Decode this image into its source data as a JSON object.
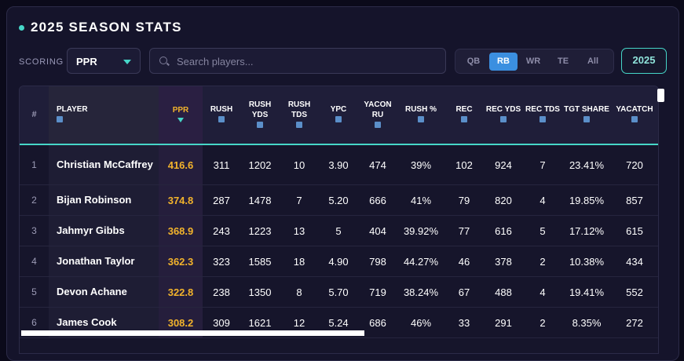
{
  "header": {
    "title": "2025 SEASON STATS"
  },
  "controls": {
    "scoring_label": "SCORING",
    "scoring_value": "PPR",
    "search_placeholder": "Search players...",
    "positions": [
      "QB",
      "RB",
      "WR",
      "TE",
      "All"
    ],
    "active_position": "RB",
    "season": "2025"
  },
  "colors": {
    "accent": "#46d6c8",
    "ppr": "#f2b32c",
    "active_tab": "#3b8fe0"
  },
  "table": {
    "columns": [
      {
        "key": "rank",
        "label": "#"
      },
      {
        "key": "player",
        "label": "PLAYER"
      },
      {
        "key": "ppr",
        "label": "PPR"
      },
      {
        "key": "rush",
        "label": "RUSH"
      },
      {
        "key": "rush_yds",
        "label": "RUSH YDS"
      },
      {
        "key": "rush_tds",
        "label": "RUSH TDS"
      },
      {
        "key": "ypc",
        "label": "YPC"
      },
      {
        "key": "yacon_ru",
        "label": "YACON RU"
      },
      {
        "key": "rush_pct",
        "label": "RUSH %"
      },
      {
        "key": "rec",
        "label": "REC"
      },
      {
        "key": "rec_yds",
        "label": "REC YDS"
      },
      {
        "key": "rec_tds",
        "label": "REC TDS"
      },
      {
        "key": "tgt_share",
        "label": "TGT SHARE"
      },
      {
        "key": "yacatch",
        "label": "YACATCH"
      }
    ],
    "rows": [
      {
        "rank": "1",
        "player": "Christian McCaffrey",
        "ppr": "416.6",
        "rush": "311",
        "rush_yds": "1202",
        "rush_tds": "10",
        "ypc": "3.90",
        "yacon_ru": "474",
        "rush_pct": "39%",
        "rec": "102",
        "rec_yds": "924",
        "rec_tds": "7",
        "tgt_share": "23.41%",
        "yacatch": "720"
      },
      {
        "rank": "2",
        "player": "Bijan Robinson",
        "ppr": "374.8",
        "rush": "287",
        "rush_yds": "1478",
        "rush_tds": "7",
        "ypc": "5.20",
        "yacon_ru": "666",
        "rush_pct": "41%",
        "rec": "79",
        "rec_yds": "820",
        "rec_tds": "4",
        "tgt_share": "19.85%",
        "yacatch": "857"
      },
      {
        "rank": "3",
        "player": "Jahmyr Gibbs",
        "ppr": "368.9",
        "rush": "243",
        "rush_yds": "1223",
        "rush_tds": "13",
        "ypc": "5",
        "yacon_ru": "404",
        "rush_pct": "39.92%",
        "rec": "77",
        "rec_yds": "616",
        "rec_tds": "5",
        "tgt_share": "17.12%",
        "yacatch": "615"
      },
      {
        "rank": "4",
        "player": "Jonathan Taylor",
        "ppr": "362.3",
        "rush": "323",
        "rush_yds": "1585",
        "rush_tds": "18",
        "ypc": "4.90",
        "yacon_ru": "798",
        "rush_pct": "44.27%",
        "rec": "46",
        "rec_yds": "378",
        "rec_tds": "2",
        "tgt_share": "10.38%",
        "yacatch": "434"
      },
      {
        "rank": "5",
        "player": "Devon Achane",
        "ppr": "322.8",
        "rush": "238",
        "rush_yds": "1350",
        "rush_tds": "8",
        "ypc": "5.70",
        "yacon_ru": "719",
        "rush_pct": "38.24%",
        "rec": "67",
        "rec_yds": "488",
        "rec_tds": "4",
        "tgt_share": "19.41%",
        "yacatch": "552"
      },
      {
        "rank": "6",
        "player": "James Cook",
        "ppr": "308.2",
        "rush": "309",
        "rush_yds": "1621",
        "rush_tds": "12",
        "ypc": "5.24",
        "yacon_ru": "686",
        "rush_pct": "46%",
        "rec": "33",
        "rec_yds": "291",
        "rec_tds": "2",
        "tgt_share": "8.35%",
        "yacatch": "272"
      }
    ]
  }
}
